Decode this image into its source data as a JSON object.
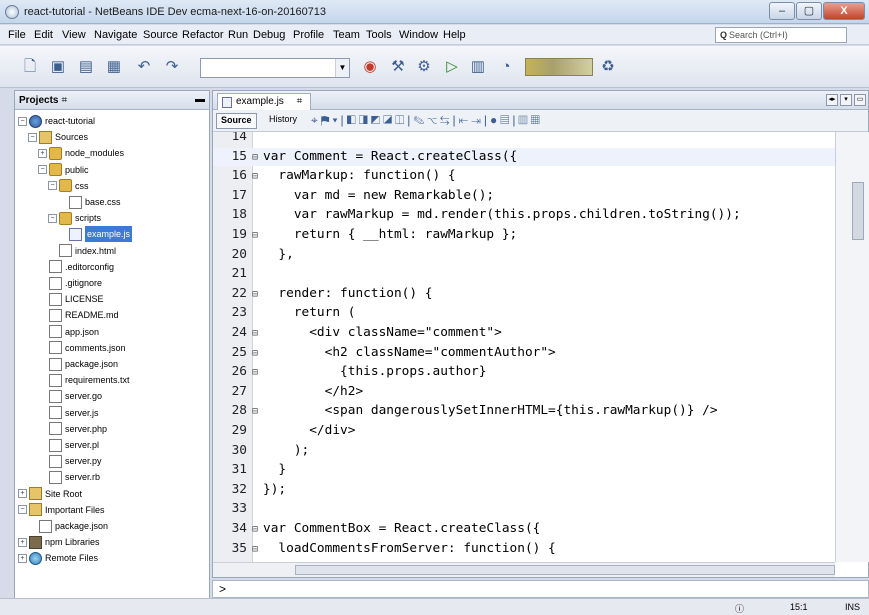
{
  "window": {
    "title": "react-tutorial - NetBeans IDE Dev ecma-next-16-on-20160713",
    "minimize": "–",
    "maximize": "▢",
    "close": "X"
  },
  "menubar": {
    "items": [
      "File",
      "Edit",
      "View",
      "Navigate",
      "Source",
      "Refactor",
      "Run",
      "Debug",
      "Profile",
      "Team",
      "Tools",
      "Window",
      "Help"
    ],
    "search_placeholder": "Search (Ctrl+I)"
  },
  "projects_panel": {
    "title": "Projects",
    "tree": [
      {
        "label": "react-tutorial",
        "depth": 0,
        "icon": "project-icon",
        "expander": "−"
      },
      {
        "label": "Sources",
        "depth": 1,
        "icon": "package-icon",
        "expander": "−"
      },
      {
        "label": "node_modules",
        "depth": 2,
        "icon": "folder-icon",
        "expander": "+"
      },
      {
        "label": "public",
        "depth": 2,
        "icon": "folder-icon",
        "expander": "−"
      },
      {
        "label": "css",
        "depth": 3,
        "icon": "folder-icon",
        "expander": "−"
      },
      {
        "label": "base.css",
        "depth": 4,
        "icon": "file-icon",
        "expander": ""
      },
      {
        "label": "scripts",
        "depth": 3,
        "icon": "folder-icon",
        "expander": "−"
      },
      {
        "label": "example.js",
        "depth": 4,
        "icon": "js-file-icon",
        "expander": "",
        "selected": true
      },
      {
        "label": "index.html",
        "depth": 3,
        "icon": "file-icon",
        "expander": ""
      },
      {
        "label": ".editorconfig",
        "depth": 2,
        "icon": "file-icon",
        "expander": ""
      },
      {
        "label": ".gitignore",
        "depth": 2,
        "icon": "file-icon",
        "expander": ""
      },
      {
        "label": "LICENSE",
        "depth": 2,
        "icon": "file-icon",
        "expander": ""
      },
      {
        "label": "README.md",
        "depth": 2,
        "icon": "file-icon",
        "expander": ""
      },
      {
        "label": "app.json",
        "depth": 2,
        "icon": "file-icon",
        "expander": ""
      },
      {
        "label": "comments.json",
        "depth": 2,
        "icon": "file-icon",
        "expander": ""
      },
      {
        "label": "package.json",
        "depth": 2,
        "icon": "file-icon",
        "expander": ""
      },
      {
        "label": "requirements.txt",
        "depth": 2,
        "icon": "file-icon",
        "expander": ""
      },
      {
        "label": "server.go",
        "depth": 2,
        "icon": "file-icon",
        "expander": ""
      },
      {
        "label": "server.js",
        "depth": 2,
        "icon": "file-icon",
        "expander": ""
      },
      {
        "label": "server.php",
        "depth": 2,
        "icon": "file-icon",
        "expander": ""
      },
      {
        "label": "server.pl",
        "depth": 2,
        "icon": "file-icon",
        "expander": ""
      },
      {
        "label": "server.py",
        "depth": 2,
        "icon": "file-icon",
        "expander": ""
      },
      {
        "label": "server.rb",
        "depth": 2,
        "icon": "file-icon",
        "expander": ""
      },
      {
        "label": "Site Root",
        "depth": 0,
        "icon": "package-icon",
        "expander": "+"
      },
      {
        "label": "Important Files",
        "depth": 0,
        "icon": "package-icon",
        "expander": "−"
      },
      {
        "label": "package.json",
        "depth": 1,
        "icon": "file-icon",
        "expander": ""
      },
      {
        "label": "npm Libraries",
        "depth": 0,
        "icon": "npm-icon",
        "expander": "+"
      },
      {
        "label": "Remote Files",
        "depth": 0,
        "icon": "globe-icon",
        "expander": "+"
      }
    ]
  },
  "editor": {
    "tab_label": "example.js",
    "source_label": "Source",
    "history_label": "History",
    "lines": [
      {
        "num": "14",
        "fold": "",
        "code": ""
      },
      {
        "num": "15",
        "fold": "⊟",
        "code": "var Comment = React.createClass({",
        "current": true
      },
      {
        "num": "16",
        "fold": "⊟",
        "code": "  rawMarkup: function() {"
      },
      {
        "num": "17",
        "fold": "",
        "code": "    var md = new Remarkable();"
      },
      {
        "num": "18",
        "fold": "",
        "code": "    var rawMarkup = md.render(this.props.children.toString());"
      },
      {
        "num": "19",
        "fold": "⊟",
        "code": "    return { __html: rawMarkup };"
      },
      {
        "num": "20",
        "fold": "",
        "code": "  },"
      },
      {
        "num": "21",
        "fold": "",
        "code": ""
      },
      {
        "num": "22",
        "fold": "⊟",
        "code": "  render: function() {"
      },
      {
        "num": "23",
        "fold": "",
        "code": "    return ("
      },
      {
        "num": "24",
        "fold": "⊟",
        "code": "      <div className=\"comment\">"
      },
      {
        "num": "25",
        "fold": "⊟",
        "code": "        <h2 className=\"commentAuthor\">"
      },
      {
        "num": "26",
        "fold": "⊟",
        "code": "          {this.props.author}"
      },
      {
        "num": "27",
        "fold": "",
        "code": "        </h2>"
      },
      {
        "num": "28",
        "fold": "⊟",
        "code": "        <span dangerouslySetInnerHTML={this.rawMarkup()} />"
      },
      {
        "num": "29",
        "fold": "",
        "code": "      </div>"
      },
      {
        "num": "30",
        "fold": "",
        "code": "    );"
      },
      {
        "num": "31",
        "fold": "",
        "code": "  }"
      },
      {
        "num": "32",
        "fold": "",
        "code": "});"
      },
      {
        "num": "33",
        "fold": "",
        "code": ""
      },
      {
        "num": "34",
        "fold": "⊟",
        "code": "var CommentBox = React.createClass({"
      },
      {
        "num": "35",
        "fold": "⊟",
        "code": "  loadCommentsFromServer: function() {"
      }
    ]
  },
  "output_prompt": ">",
  "status": {
    "position": "15:1",
    "mode": "INS"
  }
}
